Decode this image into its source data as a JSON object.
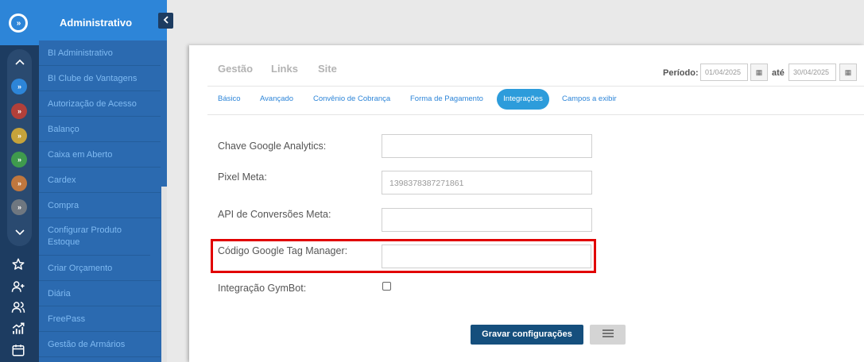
{
  "app": {
    "logo_glyph": "»"
  },
  "rail": {
    "modules": [
      {
        "name": "module-blue",
        "color": "#2d85d8"
      },
      {
        "name": "module-red",
        "color": "#b2403a"
      },
      {
        "name": "module-yellow",
        "color": "#c6a33b"
      },
      {
        "name": "module-green",
        "color": "#3f9a4d"
      },
      {
        "name": "module-orange",
        "color": "#c0773e"
      },
      {
        "name": "module-gray",
        "color": "#6f7780"
      }
    ],
    "bottom_icons": [
      "star-icon",
      "add-user-icon",
      "users-icon",
      "chart-icon",
      "calendar-icon"
    ]
  },
  "menu": {
    "title": "Administrativo",
    "items": [
      "BI Administrativo",
      "BI Clube de Vantagens",
      "Autorização de Acesso",
      "Balanço",
      "Caixa em Aberto",
      "Cardex",
      "Compra",
      "Configurar Produto Estoque",
      "Criar Orçamento",
      "Diária",
      "FreePass",
      "Gestão de Armários"
    ]
  },
  "header": {
    "tabs": [
      "Gestão",
      "Links",
      "Site"
    ],
    "periodo_label": "Período:",
    "date_from": "01/04/2025",
    "ate_label": "até",
    "date_to": "30/04/2025"
  },
  "subtabs": {
    "items": [
      "Básico",
      "Avançado",
      "Convênio de Cobrança",
      "Forma de Pagamento",
      "Integrações",
      "Campos a exibir"
    ],
    "active": "Integrações"
  },
  "form": {
    "analytics_label": "Chave Google Analytics:",
    "analytics_value": "",
    "pixel_label": "Pixel Meta:",
    "pixel_value": "1398378387271861",
    "conversoes_label": "API de Conversões Meta:",
    "conversoes_value": "",
    "gtm_label": "Código Google Tag Manager:",
    "gtm_value": "",
    "gymbot_label": "Integração GymBot:",
    "gymbot_checked": false
  },
  "actions": {
    "save_label": "Gravar configurações",
    "list_icon": "list-icon"
  },
  "colors": {
    "accent": "#2d85d8",
    "highlight": "#e10000",
    "save": "#154f7d"
  }
}
